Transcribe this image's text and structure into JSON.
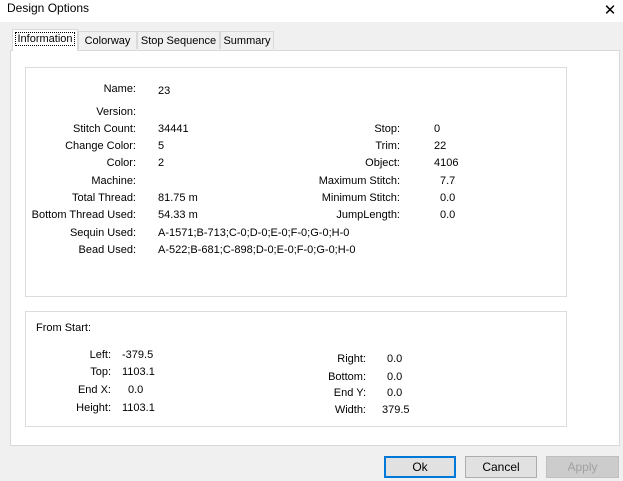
{
  "window": {
    "title": "Design Options"
  },
  "tabs": [
    {
      "label": "Information"
    },
    {
      "label": "Colorway"
    },
    {
      "label": "Stop Sequence"
    },
    {
      "label": "Summary"
    }
  ],
  "info": {
    "name": {
      "label": "Name:",
      "value": "23"
    },
    "version": {
      "label": "Version:",
      "value": ""
    },
    "stitch_count": {
      "label": "Stitch Count:",
      "value": "34441"
    },
    "change_color": {
      "label": "Change Color:",
      "value": "5"
    },
    "color": {
      "label": "Color:",
      "value": "2"
    },
    "machine": {
      "label": "Machine:",
      "value": ""
    },
    "total_thread": {
      "label": "Total Thread:",
      "value": "81.75 m"
    },
    "bottom_thread": {
      "label": "Bottom Thread Used:",
      "value": "54.33 m"
    },
    "sequin_used": {
      "label": "Sequin Used:",
      "value": "A-1571;B-713;C-0;D-0;E-0;F-0;G-0;H-0"
    },
    "bead_used": {
      "label": "Bead Used:",
      "value": "A-522;B-681;C-898;D-0;E-0;F-0;G-0;H-0"
    },
    "stop": {
      "label": "Stop:",
      "value": "0"
    },
    "trim": {
      "label": "Trim:",
      "value": "22"
    },
    "object": {
      "label": "Object:",
      "value": "4106"
    },
    "max_stitch": {
      "label": "Maximum Stitch:",
      "value": "7.7"
    },
    "min_stitch": {
      "label": "Minimum Stitch:",
      "value": "0.0"
    },
    "jump_length": {
      "label": "JumpLength:",
      "value": "0.0"
    }
  },
  "from_start": {
    "heading": "From Start:",
    "left": {
      "label": "Left:",
      "value": "-379.5"
    },
    "top": {
      "label": "Top:",
      "value": "1103.1"
    },
    "end_x": {
      "label": "End X:",
      "value": "0.0"
    },
    "height": {
      "label": "Height:",
      "value": "1103.1"
    },
    "right": {
      "label": "Right:",
      "value": "0.0"
    },
    "bottom": {
      "label": "Bottom:",
      "value": "0.0"
    },
    "end_y": {
      "label": "End Y:",
      "value": "0.0"
    },
    "width": {
      "label": "Width:",
      "value": "379.5"
    }
  },
  "buttons": {
    "ok": "Ok",
    "cancel": "Cancel",
    "apply": "Apply"
  }
}
